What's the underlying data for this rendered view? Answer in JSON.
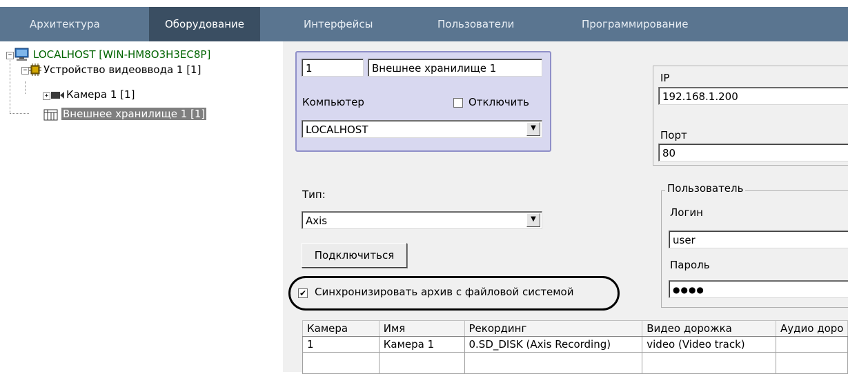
{
  "menu": {
    "items": [
      {
        "label": "Архитектура",
        "active": false
      },
      {
        "label": "Оборудование",
        "active": true
      },
      {
        "label": "Интерфейсы",
        "active": false
      },
      {
        "label": "Пользователи",
        "active": false
      },
      {
        "label": "Программирование",
        "active": false
      }
    ]
  },
  "tree": {
    "root": "LOCALHOST [WIN-HM8O3H3EC8P]",
    "device": "Устройство видеоввода 1 [1]",
    "camera": "Камера 1 [1]",
    "storage": "Внешнее хранилище 1 [1]",
    "expander_expanded": "−",
    "expander_collapsed": "+"
  },
  "form": {
    "id_value": "1",
    "name_value": "Внешнее хранилище 1",
    "computer_label": "Компьютер",
    "disable_label": "Отключить",
    "disable_checked": false,
    "computer_value": "LOCALHOST",
    "type_label": "Тип:",
    "type_value": "Axis",
    "connect_button": "Подключиться",
    "sync_label": "Синхронизировать архив с файловой системой",
    "sync_checked": true,
    "check_mark": "✔",
    "dropdown_arrow": "▼",
    "ip_label": "IP",
    "ip_value": "192.168.1.200",
    "port_label": "Порт",
    "port_value": "80",
    "user_group_label": "Пользователь",
    "login_label": "Логин",
    "login_value": "user",
    "password_label": "Пароль",
    "password_value": "●●●●"
  },
  "table": {
    "headers": [
      "Камера",
      "Имя",
      "Рекординг",
      "Видео дорожка",
      "Аудио доро"
    ],
    "rows": [
      [
        "1",
        "Камера 1",
        "0.SD_DISK (Axis Recording)",
        "video (Video track)",
        ""
      ]
    ]
  },
  "colors": {
    "menubar": "#5a7590",
    "menu_active": "#3a4e62",
    "group_box": "#d8d8f0",
    "group_border": "#8f8fc8"
  }
}
